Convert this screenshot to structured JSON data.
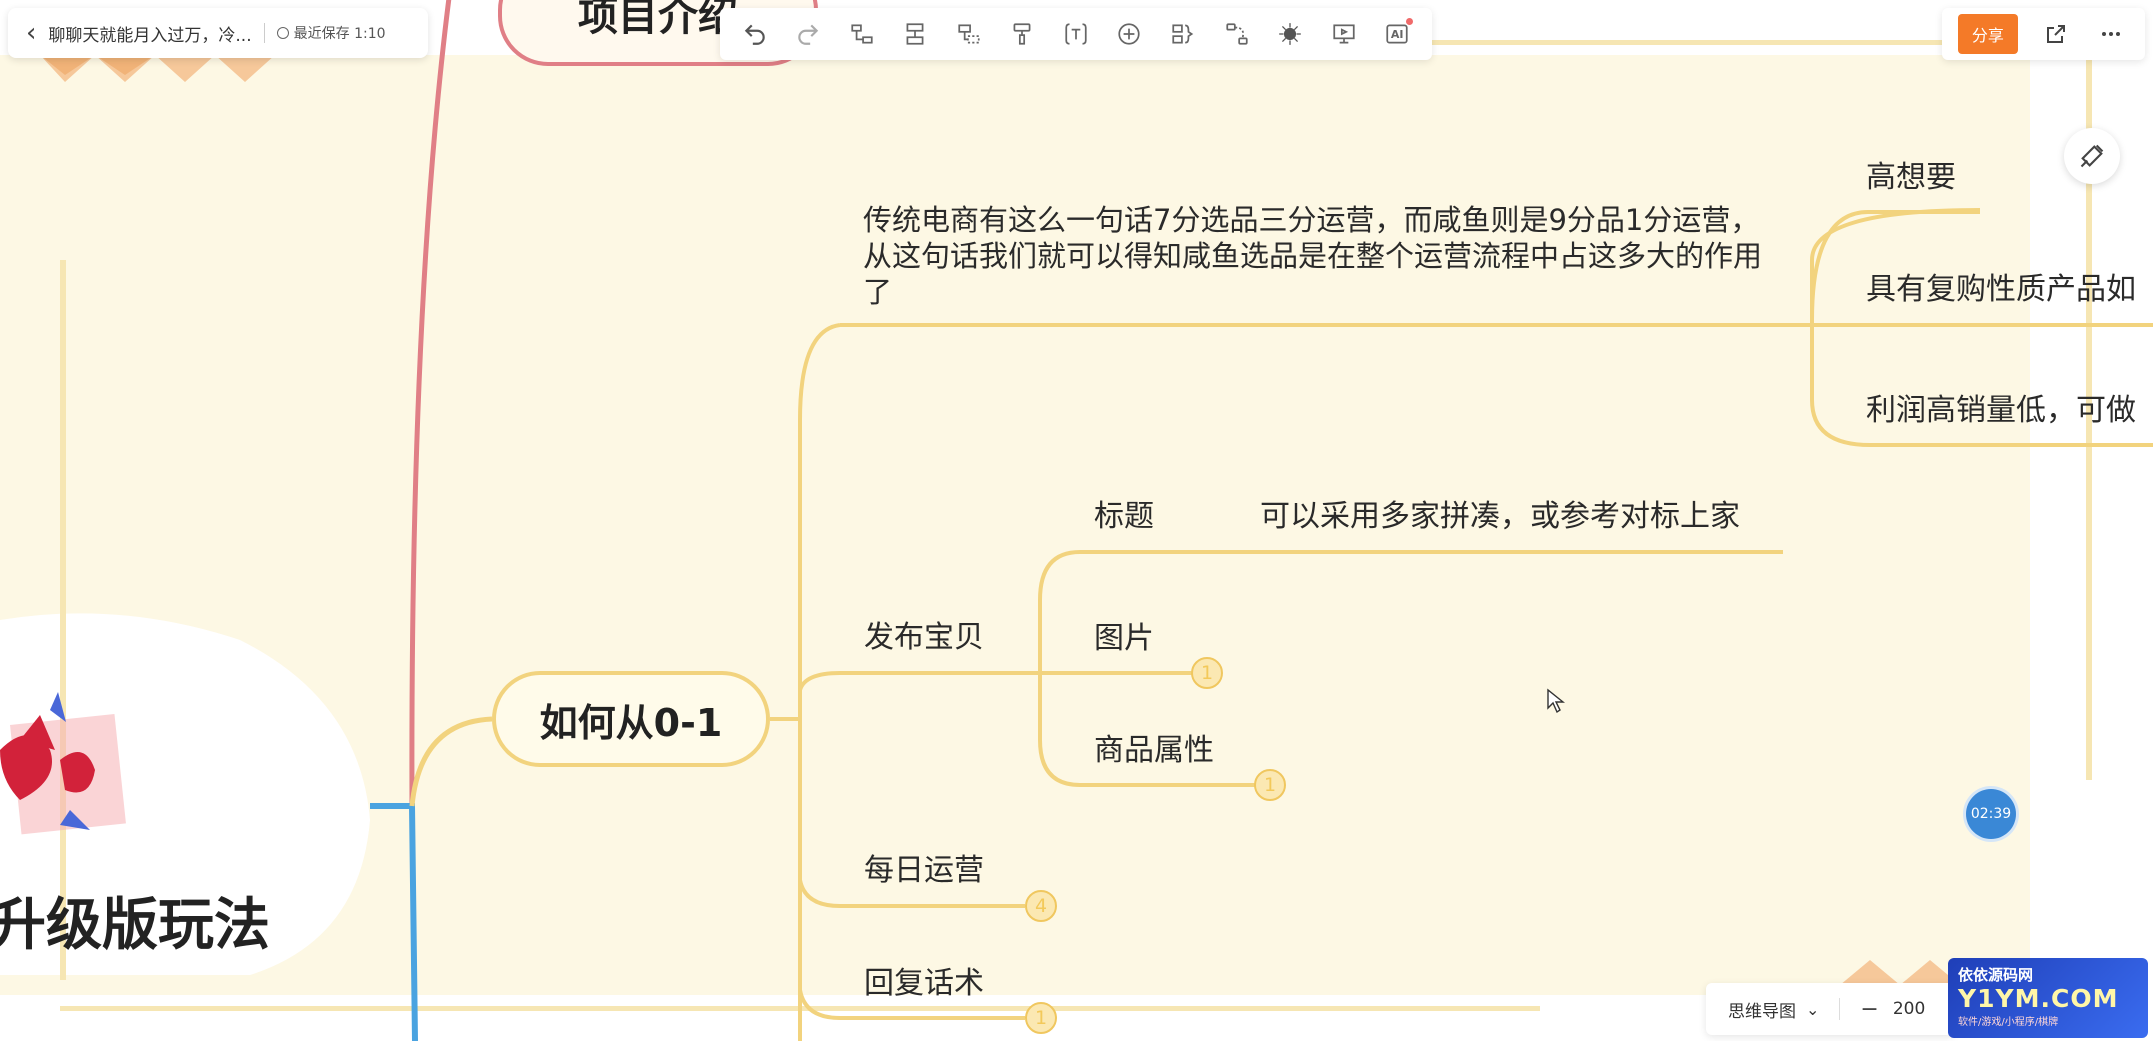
{
  "document": {
    "title": "聊聊天就能月入过万，冷...",
    "save_status": "最近保存 1:10"
  },
  "toolbar": {
    "buttons": [
      {
        "name": "undo-icon"
      },
      {
        "name": "redo-icon"
      },
      {
        "name": "subtopic-icon"
      },
      {
        "name": "sibling-topic-icon"
      },
      {
        "name": "parent-topic-icon"
      },
      {
        "name": "format-painter-icon"
      },
      {
        "name": "text-icon"
      },
      {
        "name": "insert-icon"
      },
      {
        "name": "summary-icon"
      },
      {
        "name": "relationship-icon"
      },
      {
        "name": "theme-icon"
      },
      {
        "name": "presentation-icon"
      },
      {
        "name": "ai-icon",
        "label": "AI"
      }
    ]
  },
  "header_right": {
    "share_label": "分享"
  },
  "mindmap": {
    "top_node": "项目介绍",
    "root_partial": "升级版玩法",
    "branch": "如何从0-1",
    "intro_paragraph": "传统电商有这么一句话7分选品三分运营，而咸鱼则是9分品1分运营，从这句话我们就可以得知咸鱼选品是在整个运营流程中占这多大的作用了",
    "right_items": [
      "高想要",
      "具有复购性质产品如",
      "利润高销量低，可做"
    ],
    "publish": "发布宝贝",
    "publish_children": [
      {
        "label": "标题",
        "detail": "可以采用多家拼凑，或参考对标上家"
      },
      {
        "label": "图片",
        "badge": "1"
      },
      {
        "label": "商品属性",
        "badge": "1"
      }
    ],
    "daily": {
      "label": "每日运营",
      "badge": "4"
    },
    "reply": {
      "label": "回复话术",
      "badge": "1"
    }
  },
  "timer": "02:39",
  "bottom_bar": {
    "view_mode": "思维导图",
    "zoom": "200"
  },
  "watermark": {
    "line1": "依依源码网",
    "line2": "Y1YM.COM",
    "line3": "软件/游戏/小程序/棋牌"
  },
  "colors": {
    "canvas_bg": "#fdf8e4",
    "branch_line": "#f2d37e",
    "top_line": "#e07f86",
    "blue_line": "#4aa3e0",
    "share": "#f47a28",
    "timer": "#3a88d6"
  }
}
